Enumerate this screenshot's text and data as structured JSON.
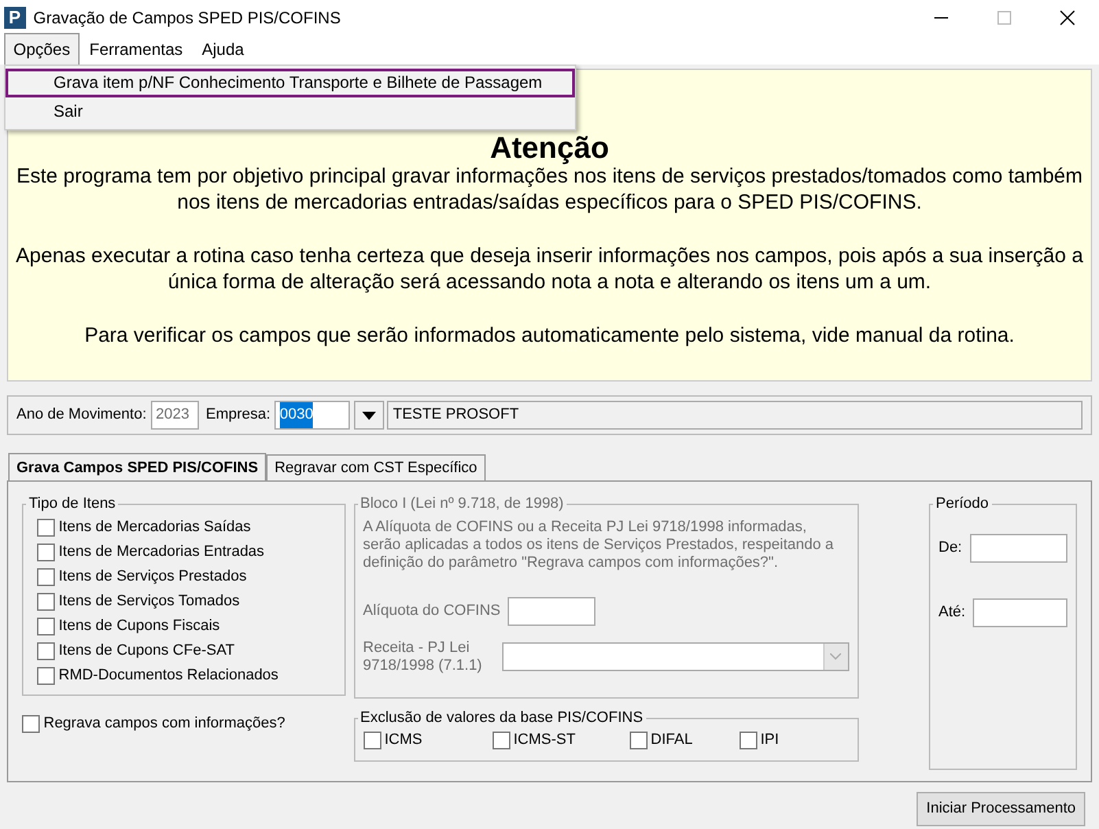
{
  "window": {
    "logo": "P",
    "title": "Gravação de Campos SPED PIS/COFINS"
  },
  "menu": [
    {
      "label": "Opções",
      "selected": true
    },
    {
      "label": "Ferramentas",
      "selected": false
    },
    {
      "label": "Ajuda",
      "selected": false
    }
  ],
  "dropdown": [
    {
      "label": "Grava item p/NF Conhecimento Transporte e Bilhete de Passagem",
      "selected": true
    },
    {
      "label": "Sair",
      "selected": false
    }
  ],
  "notice": {
    "heading": "Atenção",
    "paragraphs": [
      "Este programa tem por objetivo principal gravar informações nos itens de serviços prestados/tomados como também nos itens de mercadorias entradas/saídas específicos para o SPED PIS/COFINS.",
      "Apenas executar a rotina caso tenha certeza que deseja inserir informações nos campos, pois após a sua inserção a única forma de alteração será acessando nota a nota e alterando os itens um a um.",
      "Para verificar os campos que serão informados automaticamente pelo sistema, vide manual da rotina."
    ]
  },
  "filters": {
    "year_label": "Ano de Movimento:",
    "year_value": "2023",
    "company_label": "Empresa:",
    "company_code": "0030",
    "company_name": "TESTE PROSOFT"
  },
  "tabs": [
    {
      "label": "Grava Campos SPED PIS/COFINS",
      "selected": true
    },
    {
      "label": "Regravar com CST Específico",
      "selected": false
    }
  ],
  "item_types": {
    "title": "Tipo de Itens",
    "items": [
      {
        "label": "Itens de Mercadorias Saídas",
        "checked": false
      },
      {
        "label": "Itens de Mercadorias Entradas",
        "checked": false
      },
      {
        "label": "Itens de Serviços Prestados",
        "checked": false
      },
      {
        "label": "Itens de Serviços Tomados",
        "checked": false
      },
      {
        "label": "Itens de Cupons Fiscais",
        "checked": false
      },
      {
        "label": "Itens de Cupons CFe-SAT",
        "checked": false
      },
      {
        "label": "RMD-Documentos Relacionados",
        "checked": false
      }
    ]
  },
  "rewrite": {
    "label": "Regrava campos com informações?",
    "checked": false
  },
  "bloco": {
    "title": "Bloco I (Lei nº 9.718, de 1998)",
    "disabled": true,
    "description": "A Alíquota de COFINS ou a Receita PJ Lei 9718/1998 informadas, serão aplicadas a todos os itens de Serviços Prestados, respeitando a definição do parâmetro \"Regrava campos com informações?\".",
    "rate_label": "Alíquota do COFINS",
    "revenue_label": "Receita - PJ Lei 9718/1998 (7.1.1)"
  },
  "exclusion": {
    "title": "Exclusão de valores da base PIS/COFINS",
    "items": [
      {
        "label": "ICMS",
        "checked": false
      },
      {
        "label": "ICMS-ST",
        "checked": false
      },
      {
        "label": "DIFAL",
        "checked": false
      },
      {
        "label": "IPI",
        "checked": false
      }
    ]
  },
  "period": {
    "title": "Período",
    "from_label": "De:",
    "to_label": "Até:"
  },
  "start_button": "Iniciar Processamento"
}
